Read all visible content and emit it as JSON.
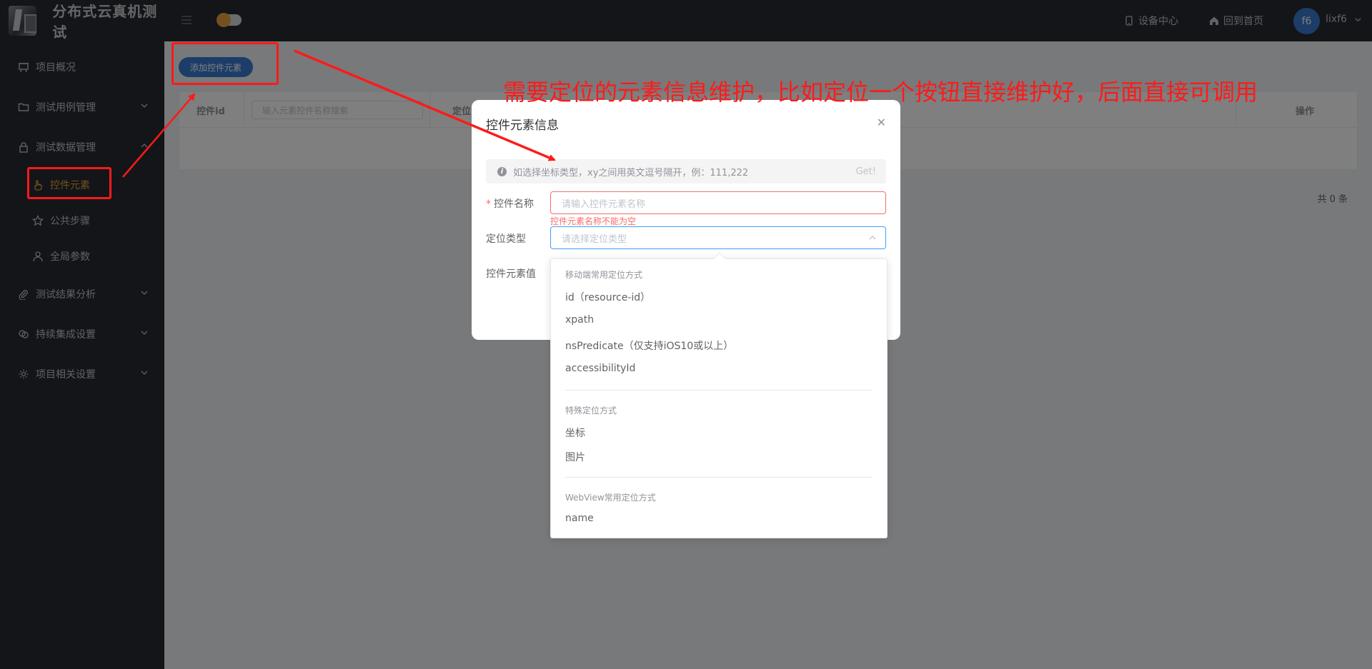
{
  "brand": {
    "title": "分布式云真机测试"
  },
  "sidebar": {
    "items": [
      {
        "label": "项目概况",
        "icon": "presentation-icon"
      },
      {
        "label": "测试用例管理",
        "icon": "folder-icon"
      },
      {
        "label": "测试数据管理",
        "icon": "lock-icon"
      },
      {
        "label": "测试结果分析",
        "icon": "paperclip-icon"
      },
      {
        "label": "持续集成设置",
        "icon": "chain-icon"
      },
      {
        "label": "项目相关设置",
        "icon": "gear-icon"
      }
    ],
    "sub_items": [
      {
        "label": "控件元素",
        "icon": "hand-pointer-icon",
        "active": true
      },
      {
        "label": "公共步骤",
        "icon": "star-icon"
      },
      {
        "label": "全局参数",
        "icon": "user-icon"
      }
    ]
  },
  "header": {
    "device_center": "设备中心",
    "home": "回到首页",
    "avatar_text": "f6",
    "username": "lixf6"
  },
  "main": {
    "add_button": "添加控件元素",
    "table": {
      "col_id": "控件id",
      "search_placeholder": "输入元素控件名称搜索",
      "col_locate": "定位",
      "col_ops": "操作",
      "total": "共 0 条"
    }
  },
  "dialog": {
    "title": "控件元素信息",
    "alert_text": "如选择坐标类型，xy之间用英文逗号隔开，例：111,222",
    "alert_action": "Get!",
    "name_label": "控件名称",
    "name_placeholder": "请输入控件元素名称",
    "name_error": "控件元素名称不能为空",
    "type_label": "定位类型",
    "type_placeholder": "请选择定位类型",
    "value_label": "控件元素值"
  },
  "dropdown": {
    "groups": [
      {
        "title": "移动端常用定位方式",
        "options": [
          "id（resource-id）",
          "xpath",
          "nsPredicate（仅支持iOS10或以上）",
          "accessibilityId"
        ]
      },
      {
        "title": "特殊定位方式",
        "options": [
          "坐标",
          "图片"
        ]
      },
      {
        "title": "WebView常用定位方式",
        "options": [
          "name"
        ]
      }
    ]
  },
  "annotation": {
    "text": "需要定位的元素信息维护，比如定位一个按钮直接维护好，后面直接可调用",
    "color": "#ff1a1a"
  },
  "colors": {
    "sidebar_bg": "#262a30",
    "accent": "#e6a23c",
    "primary": "#3a7ad3",
    "error": "#f56c6c"
  }
}
